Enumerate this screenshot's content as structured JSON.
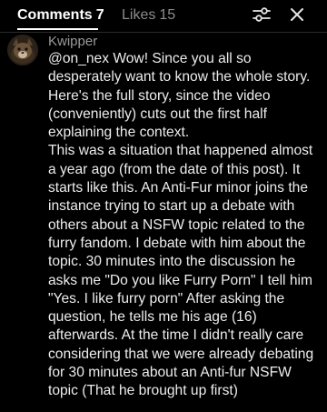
{
  "header": {
    "tabs": [
      {
        "label": "Comments",
        "count": "7"
      },
      {
        "label": "Likes",
        "count": "15"
      }
    ],
    "filter_icon": "filter-sliders-icon",
    "close_icon": "close-icon"
  },
  "comment": {
    "username": "Kwipper",
    "avatar_icon": "avatar-creature-icon",
    "text": "@on_nex Wow! Since you all so desperately want to know the whole story. Here's the full story, since the video (conveniently) cuts out the first half explaining the context.\nThis was a situation that happened almost a year ago (from the date of this post). It starts like this. An Anti-Fur minor joins the instance trying to start up a debate with others about a NSFW topic related to the furry fandom. I debate with him about the topic. 30 minutes into the discussion he asks me \"Do you like Furry Porn\" I tell him \"Yes. I like furry porn\" After asking the question, he tells me his age (16) afterwards. At the time I didn't really care considering that we were already debating for 30 minutes about an Anti-fur NSFW topic (That he brought up first)"
  },
  "colors": {
    "background": "#000000",
    "text": "#ededed",
    "muted": "#8c8c8c"
  }
}
